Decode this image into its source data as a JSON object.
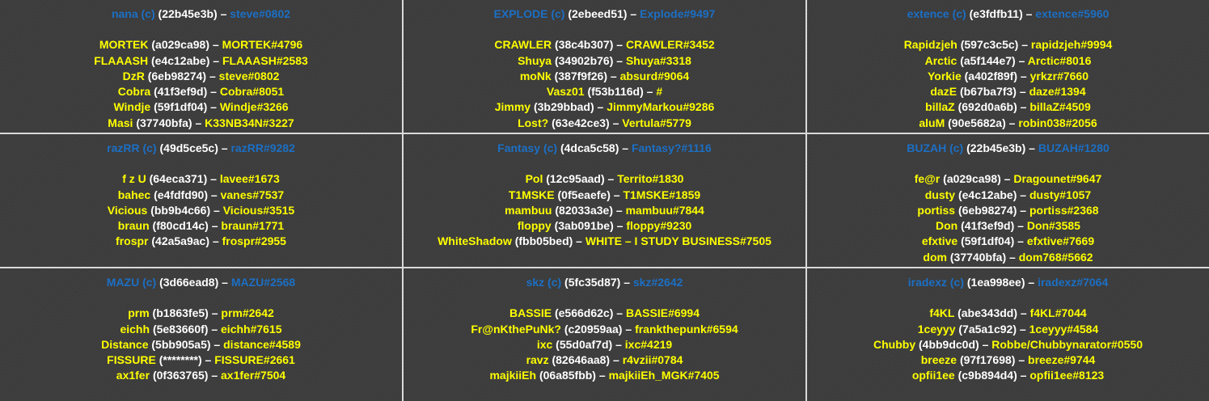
{
  "colors": {
    "team": "#1c6fc4",
    "player": "#ffff00",
    "hash": "#ffffff",
    "background": "#3a3a3a"
  },
  "dash": " – ",
  "teams": [
    {
      "captain": "nana (c)",
      "hash": "(22b45e3b)",
      "tag": "steve#0802",
      "players": [
        {
          "name": "MORTEK",
          "hash": "(a029ca98)",
          "tag": "MORTEK#4796"
        },
        {
          "name": "FLAAASH",
          "hash": "(e4c12abe)",
          "tag": "FLAAASH#2583"
        },
        {
          "name": "DzR",
          "hash": "(6eb98274)",
          "tag": "steve#0802"
        },
        {
          "name": "Cobra",
          "hash": "(41f3ef9d)",
          "tag": "Cobra#8051"
        },
        {
          "name": "Windje",
          "hash": "(59f1df04)",
          "tag": "Windje#3266"
        },
        {
          "name": "Masi",
          "hash": "(37740bfa)",
          "tag": "K33NB34N#3227"
        }
      ]
    },
    {
      "captain": "EXPLODE (c)",
      "hash": "(2ebeed51)",
      "tag": "Explode#9497",
      "players": [
        {
          "name": "CRAWLER",
          "hash": "(38c4b307)",
          "tag": "CRAWLER#3452"
        },
        {
          "name": "Shuya",
          "hash": "(34902b76)",
          "tag": "Shuya#3318"
        },
        {
          "name": "moNk",
          "hash": "(387f9f26)",
          "tag": "absurd#9064"
        },
        {
          "name": "Vasz01",
          "hash": "(f53b116d)",
          "tag": "#"
        },
        {
          "name": "Jimmy",
          "hash": "(3b29bbad)",
          "tag": "JimmyMarkou#9286"
        },
        {
          "name": "Lost?",
          "hash": "(63e42ce3)",
          "tag": "Vertula#5779"
        }
      ]
    },
    {
      "captain": "extence (c)",
      "hash": "(e3fdfb11)",
      "tag": "extence#5960",
      "players": [
        {
          "name": "Rapidzjeh",
          "hash": "(597c3c5c)",
          "tag": "rapidzjeh#9994"
        },
        {
          "name": "Arctic",
          "hash": "(a5f144e7)",
          "tag": "Arctic#8016"
        },
        {
          "name": "Yorkie",
          "hash": "(a402f89f)",
          "tag": "yrkzr#7660"
        },
        {
          "name": "dazE",
          "hash": "(b67ba7f3)",
          "tag": "daze#1394"
        },
        {
          "name": "billaZ",
          "hash": "(692d0a6b)",
          "tag": "billaZ#4509"
        },
        {
          "name": "aluM",
          "hash": "(90e5682a)",
          "tag": "robin038#2056"
        }
      ]
    },
    {
      "captain": "razRR (c)",
      "hash": "(49d5ce5c)",
      "tag": "razRR#9282",
      "players": [
        {
          "name": "f z U",
          "hash": "(64eca371)",
          "tag": "lavee#1673"
        },
        {
          "name": "bahec",
          "hash": "(e4fdfd90)",
          "tag": "vanes#7537"
        },
        {
          "name": "Vicious",
          "hash": "(bb9b4c66)",
          "tag": "Vicious#3515"
        },
        {
          "name": "braun",
          "hash": "(f80cd14c)",
          "tag": "braun#1771"
        },
        {
          "name": "frospr",
          "hash": "(42a5a9ac)",
          "tag": "frospr#2955"
        }
      ]
    },
    {
      "captain": "Fantasy (c)",
      "hash": "(4dca5c58)",
      "tag": "Fantasy?#1116",
      "players": [
        {
          "name": "Pol",
          "hash": "(12c95aad)",
          "tag": "Territo#1830"
        },
        {
          "name": "T1MSKE",
          "hash": "(0f5eaefe)",
          "tag": "T1MSKE#1859"
        },
        {
          "name": "mambuu",
          "hash": "(82033a3e)",
          "tag": "mambuu#7844"
        },
        {
          "name": "floppy",
          "hash": "(3ab091be)",
          "tag": "floppy#9230"
        },
        {
          "name": "WhiteShadow",
          "hash": "(fbb05bed)",
          "tag": "WHITE – I STUDY BUSINESS#7505"
        }
      ]
    },
    {
      "captain": "BUZAH (c)",
      "hash": "(22b45e3b)",
      "tag": "BUZAH#1280",
      "players": [
        {
          "name": "fe@r",
          "hash": "(a029ca98)",
          "tag": "Dragounet#9647"
        },
        {
          "name": "dusty",
          "hash": "(e4c12abe)",
          "tag": "dusty#1057"
        },
        {
          "name": "portiss",
          "hash": "(6eb98274)",
          "tag": "portiss#2368"
        },
        {
          "name": "Don",
          "hash": "(41f3ef9d)",
          "tag": "Don#3585"
        },
        {
          "name": "efxtive",
          "hash": "(59f1df04)",
          "tag": "efxtive#7669"
        },
        {
          "name": "dom",
          "hash": "(37740bfa)",
          "tag": "dom768#5662"
        }
      ]
    },
    {
      "captain": "MAZU (c)",
      "hash": "(3d66ead8)",
      "tag": "MAZU#2568",
      "players": [
        {
          "name": "prm",
          "hash": "(b1863fe5)",
          "tag": "prm#2642"
        },
        {
          "name": "eichh",
          "hash": "(5e83660f)",
          "tag": "eichh#7615"
        },
        {
          "name": "Distance",
          "hash": "(5bb905a5)",
          "tag": "distance#4589"
        },
        {
          "name": "FISSURE",
          "hash": "(********)",
          "tag": "FISSURE#2661"
        },
        {
          "name": "ax1fer",
          "hash": "(0f363765)",
          "tag": "ax1fer#7504"
        }
      ]
    },
    {
      "captain": "skz (c)",
      "hash": "(5fc35d87)",
      "tag": "skz#2642",
      "players": [
        {
          "name": "BASSIE",
          "hash": "(e566d62c)",
          "tag": "BASSIE#6994"
        },
        {
          "name": "Fr@nKthePuNk?",
          "hash": "(c20959aa)",
          "tag": "frankthepunk#6594"
        },
        {
          "name": "ixc",
          "hash": "(55d0af7d)",
          "tag": "ixc#4219"
        },
        {
          "name": "ravz",
          "hash": "(82646aa8)",
          "tag": "r4vzii#0784"
        },
        {
          "name": "majkiiEh",
          "hash": "(06a85fbb)",
          "tag": "majkiiEh_MGK#7405"
        }
      ]
    },
    {
      "captain": "iradexz (c)",
      "hash": "(1ea998ee)",
      "tag": "iradexz#7064",
      "players": [
        {
          "name": "f4KL",
          "hash": "(abe343dd)",
          "tag": "f4KL#7044"
        },
        {
          "name": "1ceyyy",
          "hash": "(7a5a1c92)",
          "tag": "1ceyyy#4584"
        },
        {
          "name": "Chubby",
          "hash": "(4bb9dc0d)",
          "tag": "Robbe/Chubbynarator#0550"
        },
        {
          "name": "breeze",
          "hash": "(97f17698)",
          "tag": "breeze#9744"
        },
        {
          "name": "opfii1ee",
          "hash": "(c9b894d4)",
          "tag": "opfii1ee#8123"
        }
      ]
    }
  ]
}
